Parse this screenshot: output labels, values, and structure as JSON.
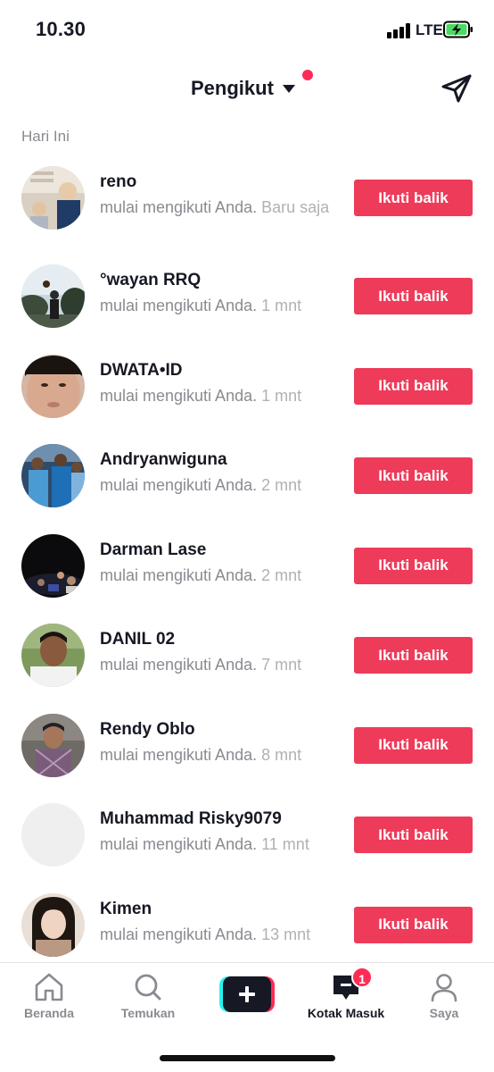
{
  "status_bar": {
    "time": "10.30",
    "network": "LTE"
  },
  "header": {
    "title": "Pengikut"
  },
  "section": {
    "label": "Hari Ini"
  },
  "follow_button_label": "Ikuti balik",
  "activity_text": "mulai mengikuti Anda.",
  "followers": [
    {
      "name": "reno",
      "time": "Baru saja"
    },
    {
      "name": "°wayan RRQ",
      "time": "1 mnt"
    },
    {
      "name": "DWATA•ID",
      "time": "1 mnt"
    },
    {
      "name": "Andryanwiguna",
      "time": "2 mnt"
    },
    {
      "name": "Darman Lase",
      "time": "2 mnt"
    },
    {
      "name": "DANIL 02",
      "time": "7 mnt"
    },
    {
      "name": "Rendy Oblo",
      "time": "8 mnt"
    },
    {
      "name": "Muhammad Risky9079",
      "time": "11 mnt"
    },
    {
      "name": "Kimen",
      "time": "13 mnt"
    }
  ],
  "bottom_nav": {
    "home": "Beranda",
    "discover": "Temukan",
    "inbox": "Kotak Masuk",
    "inbox_badge": "1",
    "profile": "Saya"
  },
  "colors": {
    "accent": "#ee3b5a",
    "badge": "#fe2c55",
    "text_primary": "#161823",
    "text_secondary": "#8a8b91"
  },
  "icons": {
    "send": "paper-plane-icon",
    "home": "home-icon",
    "discover": "search-icon",
    "create": "plus-icon",
    "inbox": "inbox-icon",
    "profile": "profile-icon"
  }
}
